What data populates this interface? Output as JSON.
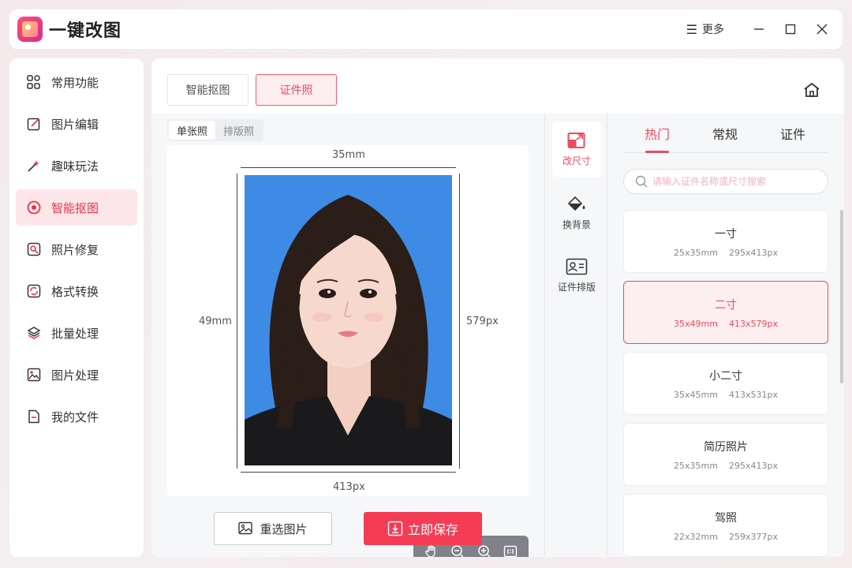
{
  "app": {
    "title": "一键改图"
  },
  "titlebar": {
    "more_label": "更多"
  },
  "sidebar": {
    "items": [
      {
        "label": "常用功能",
        "icon": "grid-icon"
      },
      {
        "label": "图片编辑",
        "icon": "edit-icon"
      },
      {
        "label": "趣味玩法",
        "icon": "magic-icon"
      },
      {
        "label": "智能抠图",
        "icon": "cutout-icon",
        "active": true
      },
      {
        "label": "照片修复",
        "icon": "repair-icon"
      },
      {
        "label": "格式转换",
        "icon": "convert-icon"
      },
      {
        "label": "批量处理",
        "icon": "layers-icon"
      },
      {
        "label": "图片处理",
        "icon": "image-icon"
      },
      {
        "label": "我的文件",
        "icon": "file-icon"
      }
    ]
  },
  "main": {
    "tabs": [
      {
        "label": "智能抠图"
      },
      {
        "label": "证件照",
        "active": true
      }
    ],
    "mode": [
      {
        "label": "单张照",
        "active": true
      },
      {
        "label": "排版照"
      }
    ],
    "dims": {
      "width_mm": "35mm",
      "height_mm": "49mm",
      "height_px": "579px",
      "width_px": "413px"
    },
    "reselect_label": "重选图片",
    "save_label": "立即保存"
  },
  "tools": [
    {
      "label": "改尺寸",
      "active": true
    },
    {
      "label": "换背景"
    },
    {
      "label": "证件排版"
    }
  ],
  "right": {
    "tabs": [
      {
        "label": "热门",
        "active": true
      },
      {
        "label": "常规"
      },
      {
        "label": "证件"
      }
    ],
    "search_placeholder": "请输入证件名称或尺寸搜索",
    "sizes": [
      {
        "name": "一寸",
        "mm": "25x35mm",
        "px": "295x413px"
      },
      {
        "name": "二寸",
        "mm": "35x49mm",
        "px": "413x579px",
        "active": true
      },
      {
        "name": "小二寸",
        "mm": "35x45mm",
        "px": "413x531px"
      },
      {
        "name": "简历照片",
        "mm": "25x35mm",
        "px": "295x413px"
      },
      {
        "name": "驾照",
        "mm": "22x32mm",
        "px": "259x377px"
      }
    ]
  },
  "colors": {
    "accent": "#ee4b61",
    "photo_bg": "#3d8be4",
    "save_button": "#f43c55"
  }
}
